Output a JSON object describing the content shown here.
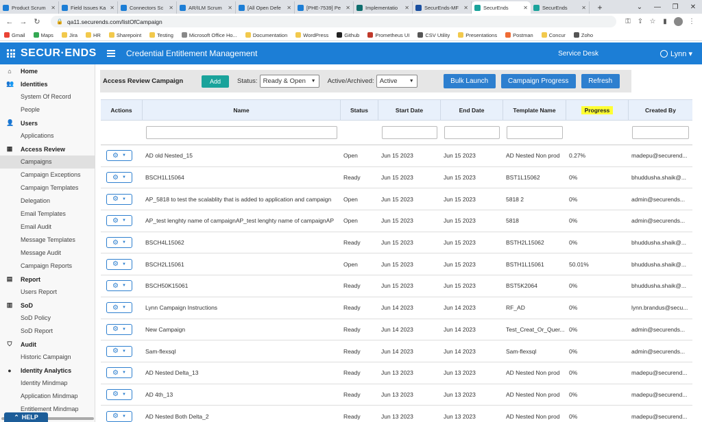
{
  "browser": {
    "tabs": [
      {
        "label": "Product Scrum",
        "color": "#1c7ed6"
      },
      {
        "label": "Field Issues Ka",
        "color": "#1c7ed6"
      },
      {
        "label": "Connectors Sc",
        "color": "#1c7ed6"
      },
      {
        "label": "AR/ILM Scrum",
        "color": "#1c7ed6"
      },
      {
        "label": "[All Open Defe",
        "color": "#1c7ed6"
      },
      {
        "label": "[PHE-7539] Pe",
        "color": "#1c7ed6"
      },
      {
        "label": "Implementatio",
        "color": "#0f6e6e"
      },
      {
        "label": "SecurEnds-MF",
        "color": "#1a4fa0"
      },
      {
        "label": "SecurEnds",
        "color": "#1aa39b"
      },
      {
        "label": "SecurEnds",
        "color": "#1aa39b"
      }
    ],
    "url": "qa11.securends.com/listOfCampaign",
    "bookmarks": [
      {
        "label": "Gmail",
        "color": "#ea4335"
      },
      {
        "label": "Maps",
        "color": "#34a853"
      },
      {
        "label": "Jira",
        "color": "#f2c94c"
      },
      {
        "label": "HR",
        "color": "#f2c94c"
      },
      {
        "label": "Sharepoint",
        "color": "#f2c94c"
      },
      {
        "label": "Testing",
        "color": "#f2c94c"
      },
      {
        "label": "Microsoft Office Ho...",
        "color": "#888888"
      },
      {
        "label": "Documentation",
        "color": "#f2c94c"
      },
      {
        "label": "WordPress",
        "color": "#f2c94c"
      },
      {
        "label": "Github",
        "color": "#222222"
      },
      {
        "label": "Prometheus UI",
        "color": "#c0392b"
      },
      {
        "label": "CSV Utility",
        "color": "#555555"
      },
      {
        "label": "Presentations",
        "color": "#f2c94c"
      },
      {
        "label": "Postman",
        "color": "#ef6c35"
      },
      {
        "label": "Concur",
        "color": "#f2c94c"
      },
      {
        "label": "Zoho",
        "color": "#555555"
      }
    ]
  },
  "header": {
    "logo": "SECUR·ENDS",
    "title": "Credential Entitlement Management",
    "service_desk": "Service Desk",
    "user": "Lynn ▾"
  },
  "sidebar": {
    "sections": [
      {
        "label": "Home",
        "icon": "⌂",
        "items": []
      },
      {
        "label": "Identities",
        "icon": "👥",
        "items": [
          "System Of Record",
          "People"
        ]
      },
      {
        "label": "Users",
        "icon": "👤",
        "items": [
          "Applications"
        ]
      },
      {
        "label": "Access Review",
        "icon": "▦",
        "items": [
          "Campaigns",
          "Campaign Exceptions",
          "Campaign Templates",
          "Delegation",
          "Email Templates",
          "Email Audit",
          "Message Templates",
          "Message Audit",
          "Campaign Reports"
        ]
      },
      {
        "label": "Report",
        "icon": "▤",
        "items": [
          "Users Report"
        ]
      },
      {
        "label": "SoD",
        "icon": "▥",
        "items": [
          "SoD Policy",
          "SoD Report"
        ]
      },
      {
        "label": "Audit",
        "icon": "⛉",
        "items": [
          "Historic Campaign"
        ]
      },
      {
        "label": "Identity Analytics",
        "icon": "●",
        "items": [
          "Identity Mindmap",
          "Application Mindmap",
          "Entitlement Mindmap"
        ]
      }
    ],
    "active_item": "Campaigns",
    "help": "HELP"
  },
  "toolbar": {
    "title": "Access Review Campaign",
    "add": "Add",
    "status_label": "Status:",
    "status_value": "Ready & Open",
    "archived_label": "Active/Archived:",
    "archived_value": "Active",
    "bulk_launch": "Bulk Launch",
    "campaign_progress": "Campaign Progress",
    "refresh": "Refresh"
  },
  "table": {
    "columns": [
      "Actions",
      "Name",
      "Status",
      "Start Date",
      "End Date",
      "Template Name",
      "Progress",
      "Created By"
    ],
    "rows": [
      {
        "name": "AD old Nested_15",
        "status": "Open",
        "start": "Jun 15 2023",
        "end": "Jun 15 2023",
        "template": "AD Nested Non prod",
        "progress": "0.27%",
        "created_by": "madepu@securend..."
      },
      {
        "name": "BSCH1L15064",
        "status": "Ready",
        "start": "Jun 15 2023",
        "end": "Jun 15 2023",
        "template": "BST1L15062",
        "progress": "0%",
        "created_by": "bhuddusha.shaik@..."
      },
      {
        "name": "AP_5818 to test the scalablity that is added to application and campaign",
        "status": "Open",
        "start": "Jun 15 2023",
        "end": "Jun 15 2023",
        "template": "5818 2",
        "progress": "0%",
        "created_by": "admin@securends..."
      },
      {
        "name": "AP_test lenghty name of campaignAP_test lenghty name of campaignAP",
        "status": "Open",
        "start": "Jun 15 2023",
        "end": "Jun 15 2023",
        "template": "5818",
        "progress": "0%",
        "created_by": "admin@securends..."
      },
      {
        "name": "BSCH4L15062",
        "status": "Ready",
        "start": "Jun 15 2023",
        "end": "Jun 15 2023",
        "template": "BSTH2L15062",
        "progress": "0%",
        "created_by": "bhuddusha.shaik@..."
      },
      {
        "name": "BSCH2L15061",
        "status": "Open",
        "start": "Jun 15 2023",
        "end": "Jun 15 2023",
        "template": "BSTH1L15061",
        "progress": "50.01%",
        "created_by": "bhuddusha.shaik@..."
      },
      {
        "name": "BSCH50K15061",
        "status": "Ready",
        "start": "Jun 15 2023",
        "end": "Jun 15 2023",
        "template": "BST5K2064",
        "progress": "0%",
        "created_by": "bhuddusha.shaik@..."
      },
      {
        "name": "Lynn Campaign Instructions",
        "status": "Ready",
        "start": "Jun 14 2023",
        "end": "Jun 14 2023",
        "template": "RF_AD",
        "progress": "0%",
        "created_by": "lynn.brandus@secu..."
      },
      {
        "name": "New Campaign",
        "status": "Ready",
        "start": "Jun 14 2023",
        "end": "Jun 14 2023",
        "template": "Test_Creat_Or_Quer...",
        "progress": "0%",
        "created_by": "admin@securends..."
      },
      {
        "name": "Sam-flexsql",
        "status": "Ready",
        "start": "Jun 14 2023",
        "end": "Jun 14 2023",
        "template": "Sam-flexsql",
        "progress": "0%",
        "created_by": "admin@securends..."
      },
      {
        "name": "AD Nested Delta_13",
        "status": "Ready",
        "start": "Jun 13 2023",
        "end": "Jun 13 2023",
        "template": "AD Nested Non prod",
        "progress": "0%",
        "created_by": "madepu@securend..."
      },
      {
        "name": "AD 4th_13",
        "status": "Ready",
        "start": "Jun 13 2023",
        "end": "Jun 13 2023",
        "template": "AD Nested Non prod",
        "progress": "0%",
        "created_by": "madepu@securend..."
      },
      {
        "name": "AD Nested Both Delta_2",
        "status": "Ready",
        "start": "Jun 13 2023",
        "end": "Jun 13 2023",
        "template": "AD Nested Non prod",
        "progress": "0%",
        "created_by": "madepu@securend..."
      }
    ]
  }
}
